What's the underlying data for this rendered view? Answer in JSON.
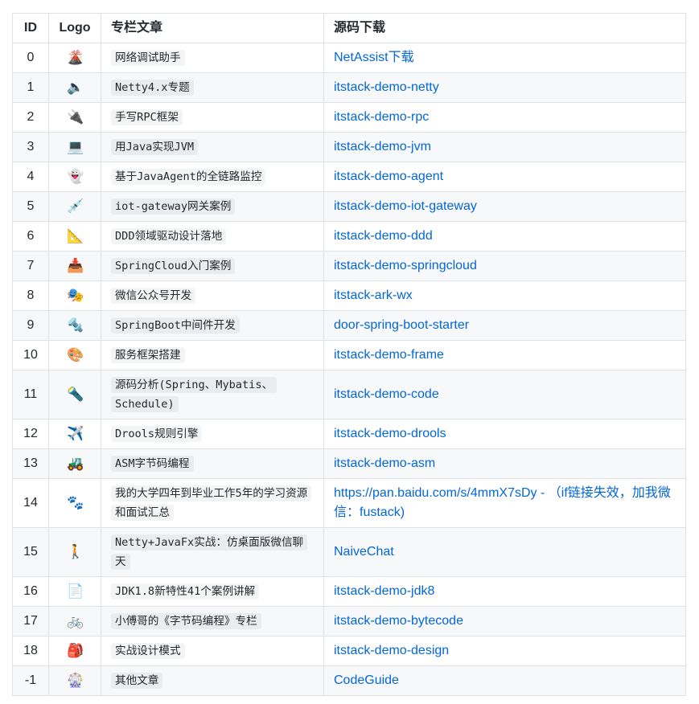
{
  "table": {
    "headers": {
      "id": "ID",
      "logo": "Logo",
      "article": "专栏文章",
      "source": "源码下载"
    },
    "rows": [
      {
        "id": "0",
        "logo": "🌋",
        "article": "网络调试助手",
        "source": "NetAssist下载"
      },
      {
        "id": "1",
        "logo": "🔈",
        "article": "Netty4.x专题",
        "source": "itstack-demo-netty"
      },
      {
        "id": "2",
        "logo": "🔌",
        "article": "手写RPC框架",
        "source": "itstack-demo-rpc"
      },
      {
        "id": "3",
        "logo": "💻",
        "article": "用Java实现JVM",
        "source": "itstack-demo-jvm"
      },
      {
        "id": "4",
        "logo": "👻",
        "article": "基于JavaAgent的全链路监控",
        "source": "itstack-demo-agent"
      },
      {
        "id": "5",
        "logo": "💉",
        "article": "iot-gateway网关案例",
        "source": "itstack-demo-iot-gateway"
      },
      {
        "id": "6",
        "logo": "📐",
        "article": "DDD领域驱动设计落地",
        "source": "itstack-demo-ddd"
      },
      {
        "id": "7",
        "logo": "📥",
        "article": "SpringCloud入门案例",
        "source": "itstack-demo-springcloud"
      },
      {
        "id": "8",
        "logo": "🎭",
        "article": "微信公众号开发",
        "source": "itstack-ark-wx"
      },
      {
        "id": "9",
        "logo": "🔩",
        "article": "SpringBoot中间件开发",
        "source": "door-spring-boot-starter"
      },
      {
        "id": "10",
        "logo": "🎨",
        "article": "服务框架搭建",
        "source": "itstack-demo-frame"
      },
      {
        "id": "11",
        "logo": "🔦",
        "article": "源码分析(Spring、Mybatis、Schedule)",
        "source": "itstack-demo-code"
      },
      {
        "id": "12",
        "logo": "✈️",
        "article": "Drools规则引擎",
        "source": "itstack-demo-drools"
      },
      {
        "id": "13",
        "logo": "🚜",
        "article": "ASM字节码编程",
        "source": "itstack-demo-asm"
      },
      {
        "id": "14",
        "logo": "🐾",
        "article": "我的大学四年到毕业工作5年的学习资源和面试汇总",
        "source": "https://pan.baidu.com/s/4mmX7sDy - （if链接失效，加我微信：fustack)"
      },
      {
        "id": "15",
        "logo": "🚶",
        "article": "Netty+JavaFx实战：仿桌面版微信聊天",
        "source": "NaiveChat"
      },
      {
        "id": "16",
        "logo": "📄",
        "article": "JDK1.8新特性41个案例讲解",
        "source": "itstack-demo-jdk8"
      },
      {
        "id": "17",
        "logo": "🚲",
        "article": "小傅哥的《字节码编程》专栏",
        "source": "itstack-demo-bytecode"
      },
      {
        "id": "18",
        "logo": "🎒",
        "article": "实战设计模式",
        "source": "itstack-demo-design"
      },
      {
        "id": "-1",
        "logo": "🎡",
        "article": "其他文章",
        "source": "CodeGuide"
      }
    ]
  },
  "colors": {
    "link": "#0366d6",
    "border": "#dfe2e5",
    "stripe": "#f6f8fa",
    "text": "#24292e"
  }
}
